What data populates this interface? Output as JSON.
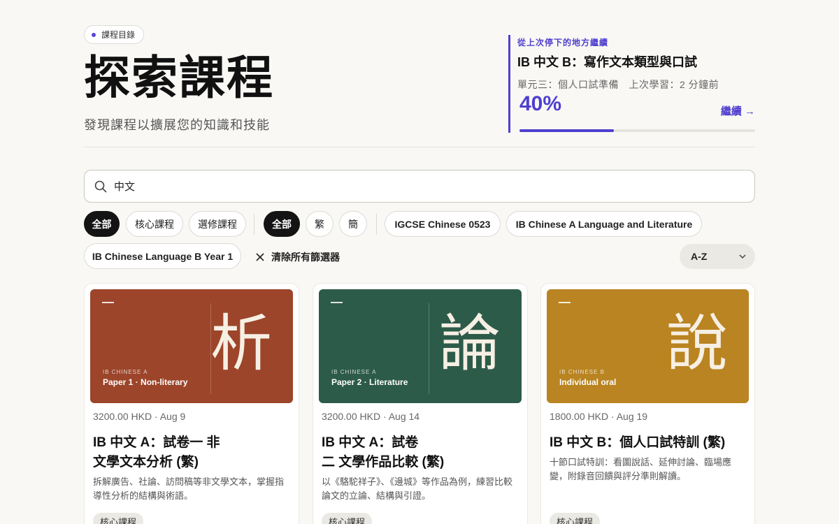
{
  "header": {
    "badge": "課程目錄",
    "title": "探索課程",
    "subtitle": "發現課程以擴展您的知識和技能"
  },
  "resume": {
    "kicker": "從上次停下的地方繼續",
    "course": "IB 中文 B：寫作文本類型與口試",
    "meta": "單元三：個人口試準備　上次學習：2 分鐘前",
    "percent_label": "40%",
    "progress": 0.4,
    "continue_label": "繼續 →"
  },
  "search": {
    "value": "中文"
  },
  "filters": {
    "type": [
      "全部",
      "核心課程",
      "選修課程"
    ],
    "script": [
      "全部",
      "繁",
      "簡"
    ],
    "programs": [
      "IGCSE Chinese 0523",
      "IB Chinese A Language and Literature",
      "IB Chinese Language B Year 1"
    ],
    "clear_label": "清除所有篩選器",
    "sort_value": "A-Z"
  },
  "courses": [
    {
      "cover_glyph": "析",
      "cover_series": "IB CHINESE A",
      "cover_title": "Paper 1 · Non-literary",
      "cover_color": "#9c452a",
      "price": "3200.00 HKD · Aug 9",
      "title_line1": "IB 中文 A：試卷一 非",
      "title_line2": "文學文本分析 (繁)",
      "desc": "拆解廣告、社論、訪問稿等非文學文本，掌握指導性分析的結構與術語。",
      "tag": "核心課程"
    },
    {
      "cover_glyph": "論",
      "cover_series": "IB CHINESE A",
      "cover_title": "Paper 2 · Literature",
      "cover_color": "#2d5b4a",
      "price": "3200.00 HKD · Aug 14",
      "title_line1": "IB 中文 A：試卷",
      "title_line2": "二 文學作品比較 (繁)",
      "desc": "以《駱駝祥子》、《邊城》等作品為例，練習比較論文的立論、結構與引證。",
      "tag": "核心課程"
    },
    {
      "cover_glyph": "說",
      "cover_series": "IB CHINESE B",
      "cover_title": "Individual oral",
      "cover_color": "#b98421",
      "price": "1800.00 HKD · Aug 19",
      "title_line1": "IB 中文 B：個人口試特訓 (繁)",
      "title_line2": "",
      "desc": "十節口試特訓：看圖說話、延伸討論、臨場應變，附錄音回饋與評分準則解讀。",
      "tag": "核心課程"
    }
  ],
  "icons": {
    "search": "search-icon",
    "close": "close-icon",
    "chevron": "chevron-down-icon"
  },
  "colors": {
    "accent": "#4f3fcf",
    "chip_active": "#141414"
  }
}
